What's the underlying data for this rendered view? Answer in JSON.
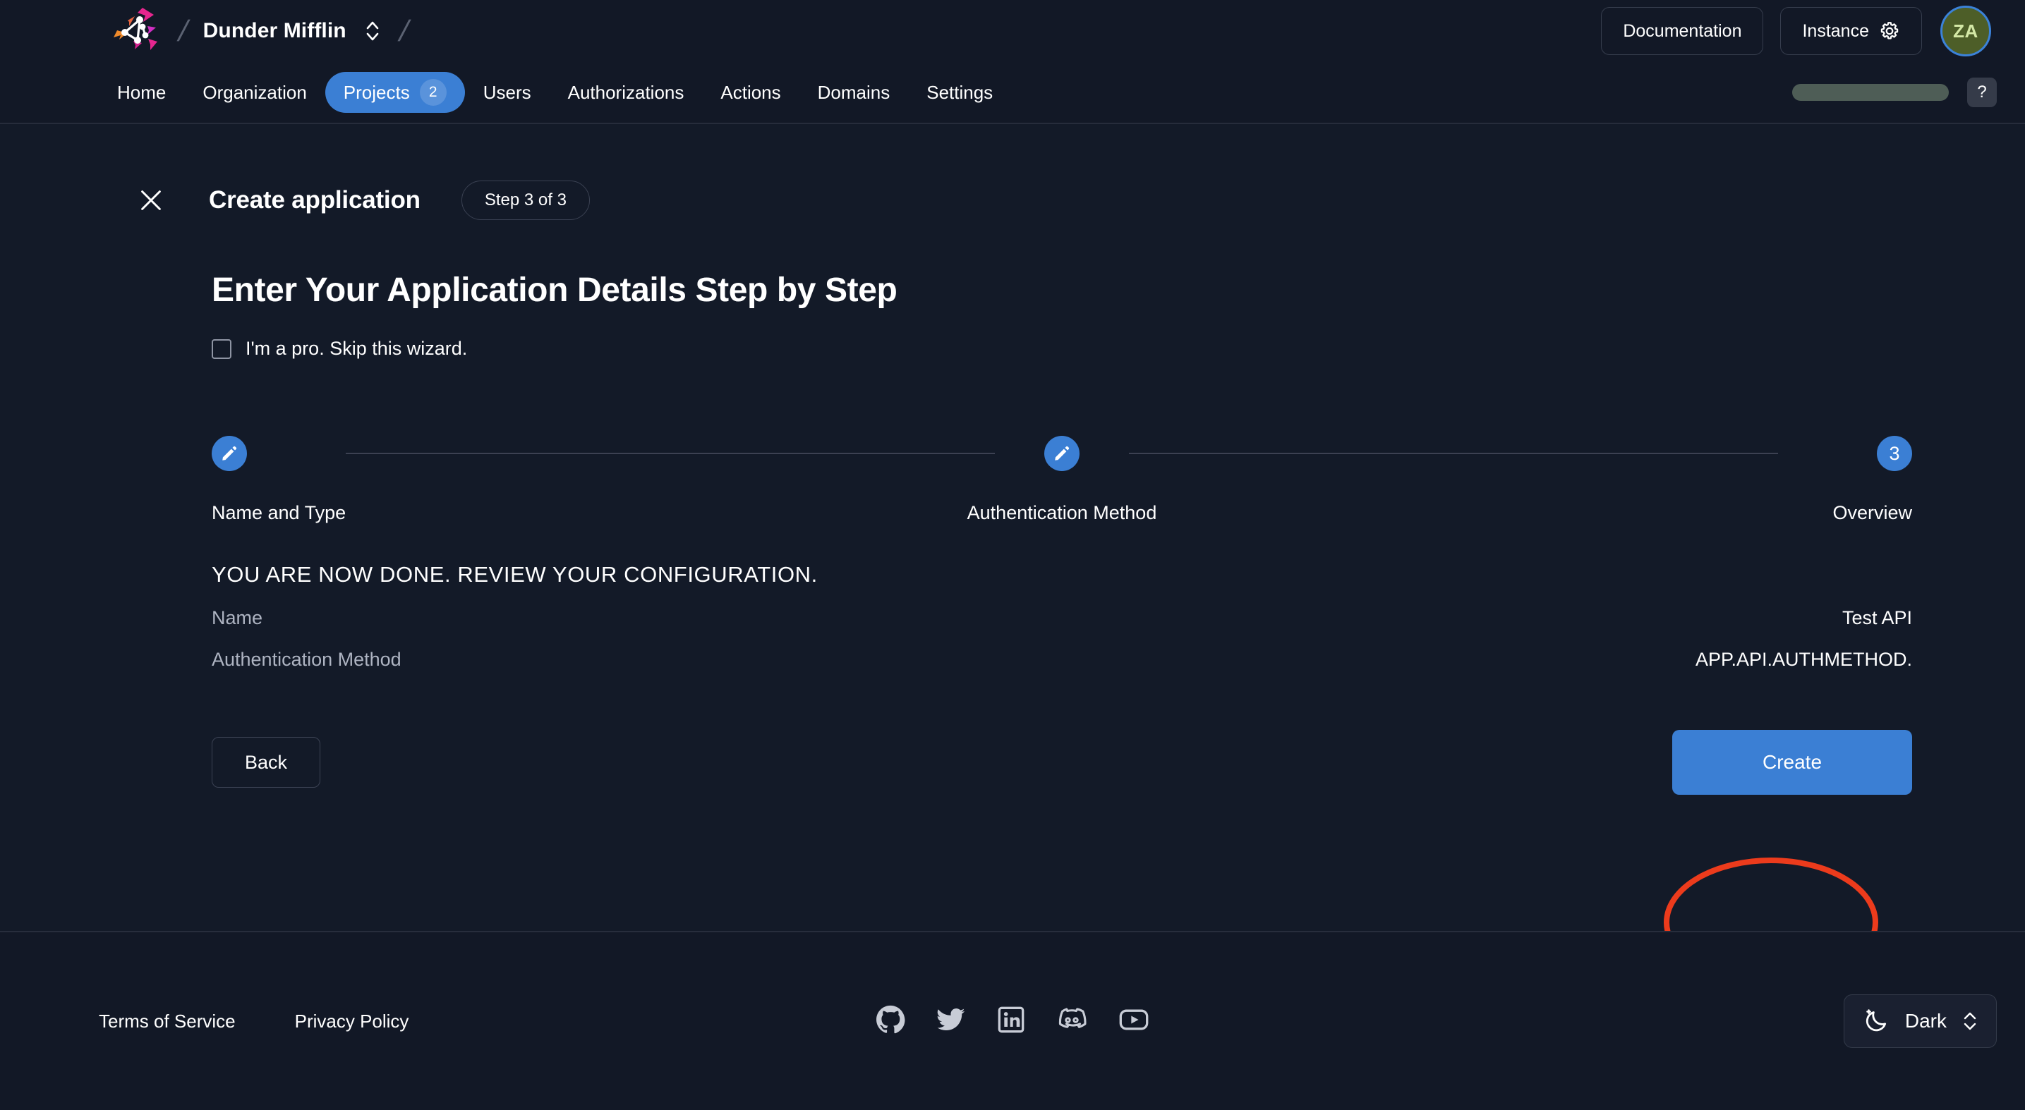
{
  "topbar": {
    "logo": "zitadel-logo-icon",
    "org_name": "Dunder Mifflin",
    "org_switch_icon": "chevron-up-down-icon",
    "documentation_label": "Documentation",
    "instance_label": "Instance",
    "instance_icon": "gear-icon",
    "avatar_initials": "ZA",
    "avatar_bg": "#4d5e28",
    "avatar_ring": "#3b82d9",
    "avatar_text_color": "#d4e8a6"
  },
  "nav": {
    "items": [
      {
        "label": "Home",
        "active": false
      },
      {
        "label": "Organization",
        "active": false
      },
      {
        "label": "Projects",
        "active": true,
        "badge": "2"
      },
      {
        "label": "Users",
        "active": false
      },
      {
        "label": "Authorizations",
        "active": false
      },
      {
        "label": "Actions",
        "active": false
      },
      {
        "label": "Domains",
        "active": false
      },
      {
        "label": "Settings",
        "active": false
      }
    ],
    "active_color": "#3b7fd4",
    "pill_color": "#4e5d56",
    "help_label": "?"
  },
  "modal": {
    "close_icon": "close-icon",
    "title": "Create application",
    "step_chip": "Step 3 of 3",
    "heading": "Enter Your Application Details Step by Step",
    "skip_checkbox_label": "I'm a pro. Skip this wizard.",
    "skip_checked": false
  },
  "stepper": {
    "accent": "#3b7fd4",
    "steps": [
      {
        "label": "Name and Type",
        "marker": "pencil-icon",
        "state": "complete"
      },
      {
        "label": "Authentication Method",
        "marker": "pencil-icon",
        "state": "complete"
      },
      {
        "label": "Overview",
        "marker": "3",
        "state": "current"
      }
    ]
  },
  "review": {
    "title": "YOU ARE NOW DONE. REVIEW YOUR CONFIGURATION.",
    "rows": [
      {
        "key": "Name",
        "value": "Test API"
      },
      {
        "key": "Authentication Method",
        "value": "APP.API.AUTHMETHOD."
      }
    ]
  },
  "actions": {
    "back_label": "Back",
    "create_label": "Create",
    "create_color": "#3b7fd4",
    "annotation_color": "#ec3b1c"
  },
  "footer": {
    "terms_label": "Terms of Service",
    "privacy_label": "Privacy Policy",
    "socials": [
      "github-icon",
      "twitter-icon",
      "linkedin-icon",
      "discord-icon",
      "youtube-icon"
    ],
    "theme_icon": "moon-icon",
    "theme_label": "Dark",
    "theme_switch_icon": "chevron-up-down-icon"
  }
}
